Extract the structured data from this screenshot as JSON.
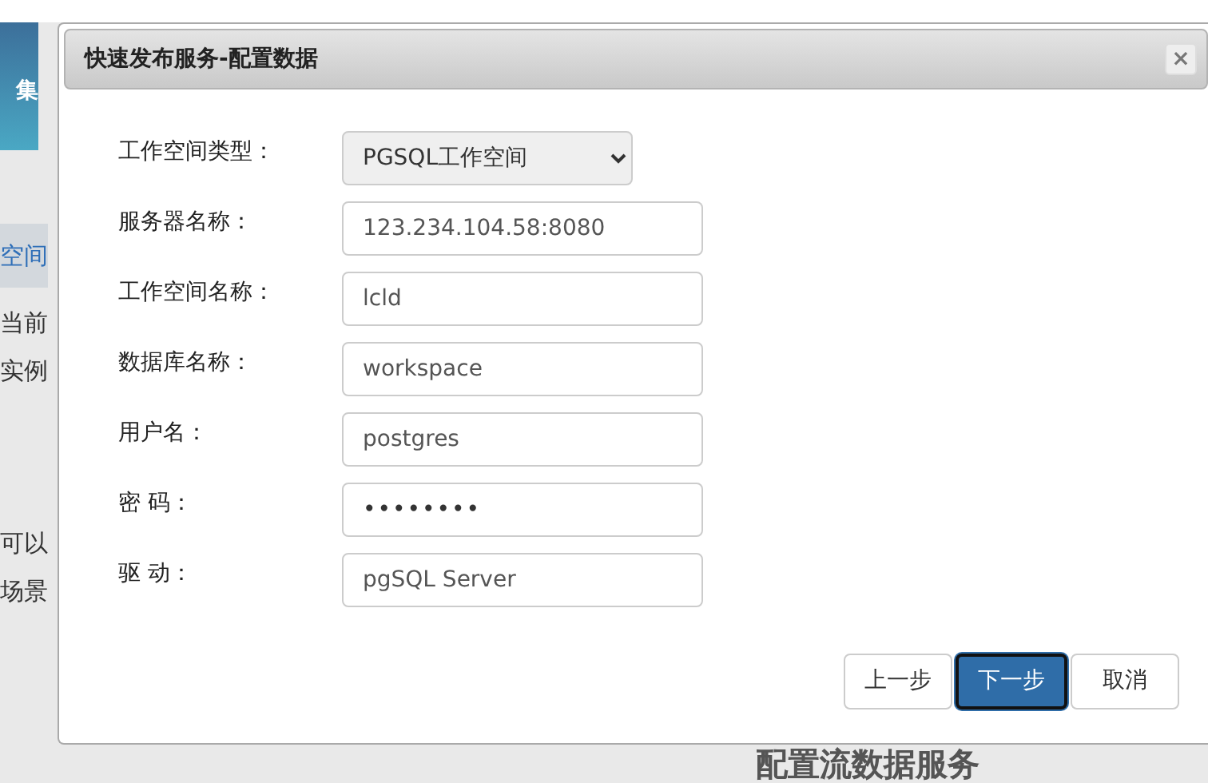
{
  "background_page": {
    "header_text": "集",
    "nav_item": {
      "label": "空间",
      "selected": true
    },
    "texts": [
      "当前",
      "实例"
    ],
    "notes": [
      "可以",
      "场景"
    ],
    "section_heading": "配置流数据服务"
  },
  "dialog": {
    "title": "快速发布服务-配置数据",
    "close": "×",
    "fields": [
      {
        "kind": "select",
        "label": "工作空间类型：",
        "value": "PGSQL工作空间"
      },
      {
        "kind": "text",
        "label": "服务器名称：",
        "value": "123.234.104.58:8080"
      },
      {
        "kind": "text",
        "label": "工作空间名称：",
        "value": "lcld"
      },
      {
        "kind": "text",
        "label": "数据库名称：",
        "value": "workspace"
      },
      {
        "kind": "text",
        "label": "用户名：",
        "value": "postgres"
      },
      {
        "kind": "password",
        "label": "密 码：",
        "value": "••••••••"
      },
      {
        "kind": "text",
        "label": "驱 动：",
        "value": "pgSQL Server"
      }
    ],
    "buttons": [
      {
        "label": "上一步",
        "primary": false
      },
      {
        "label": "下一步",
        "primary": true
      },
      {
        "label": "取消",
        "primary": false
      }
    ]
  }
}
